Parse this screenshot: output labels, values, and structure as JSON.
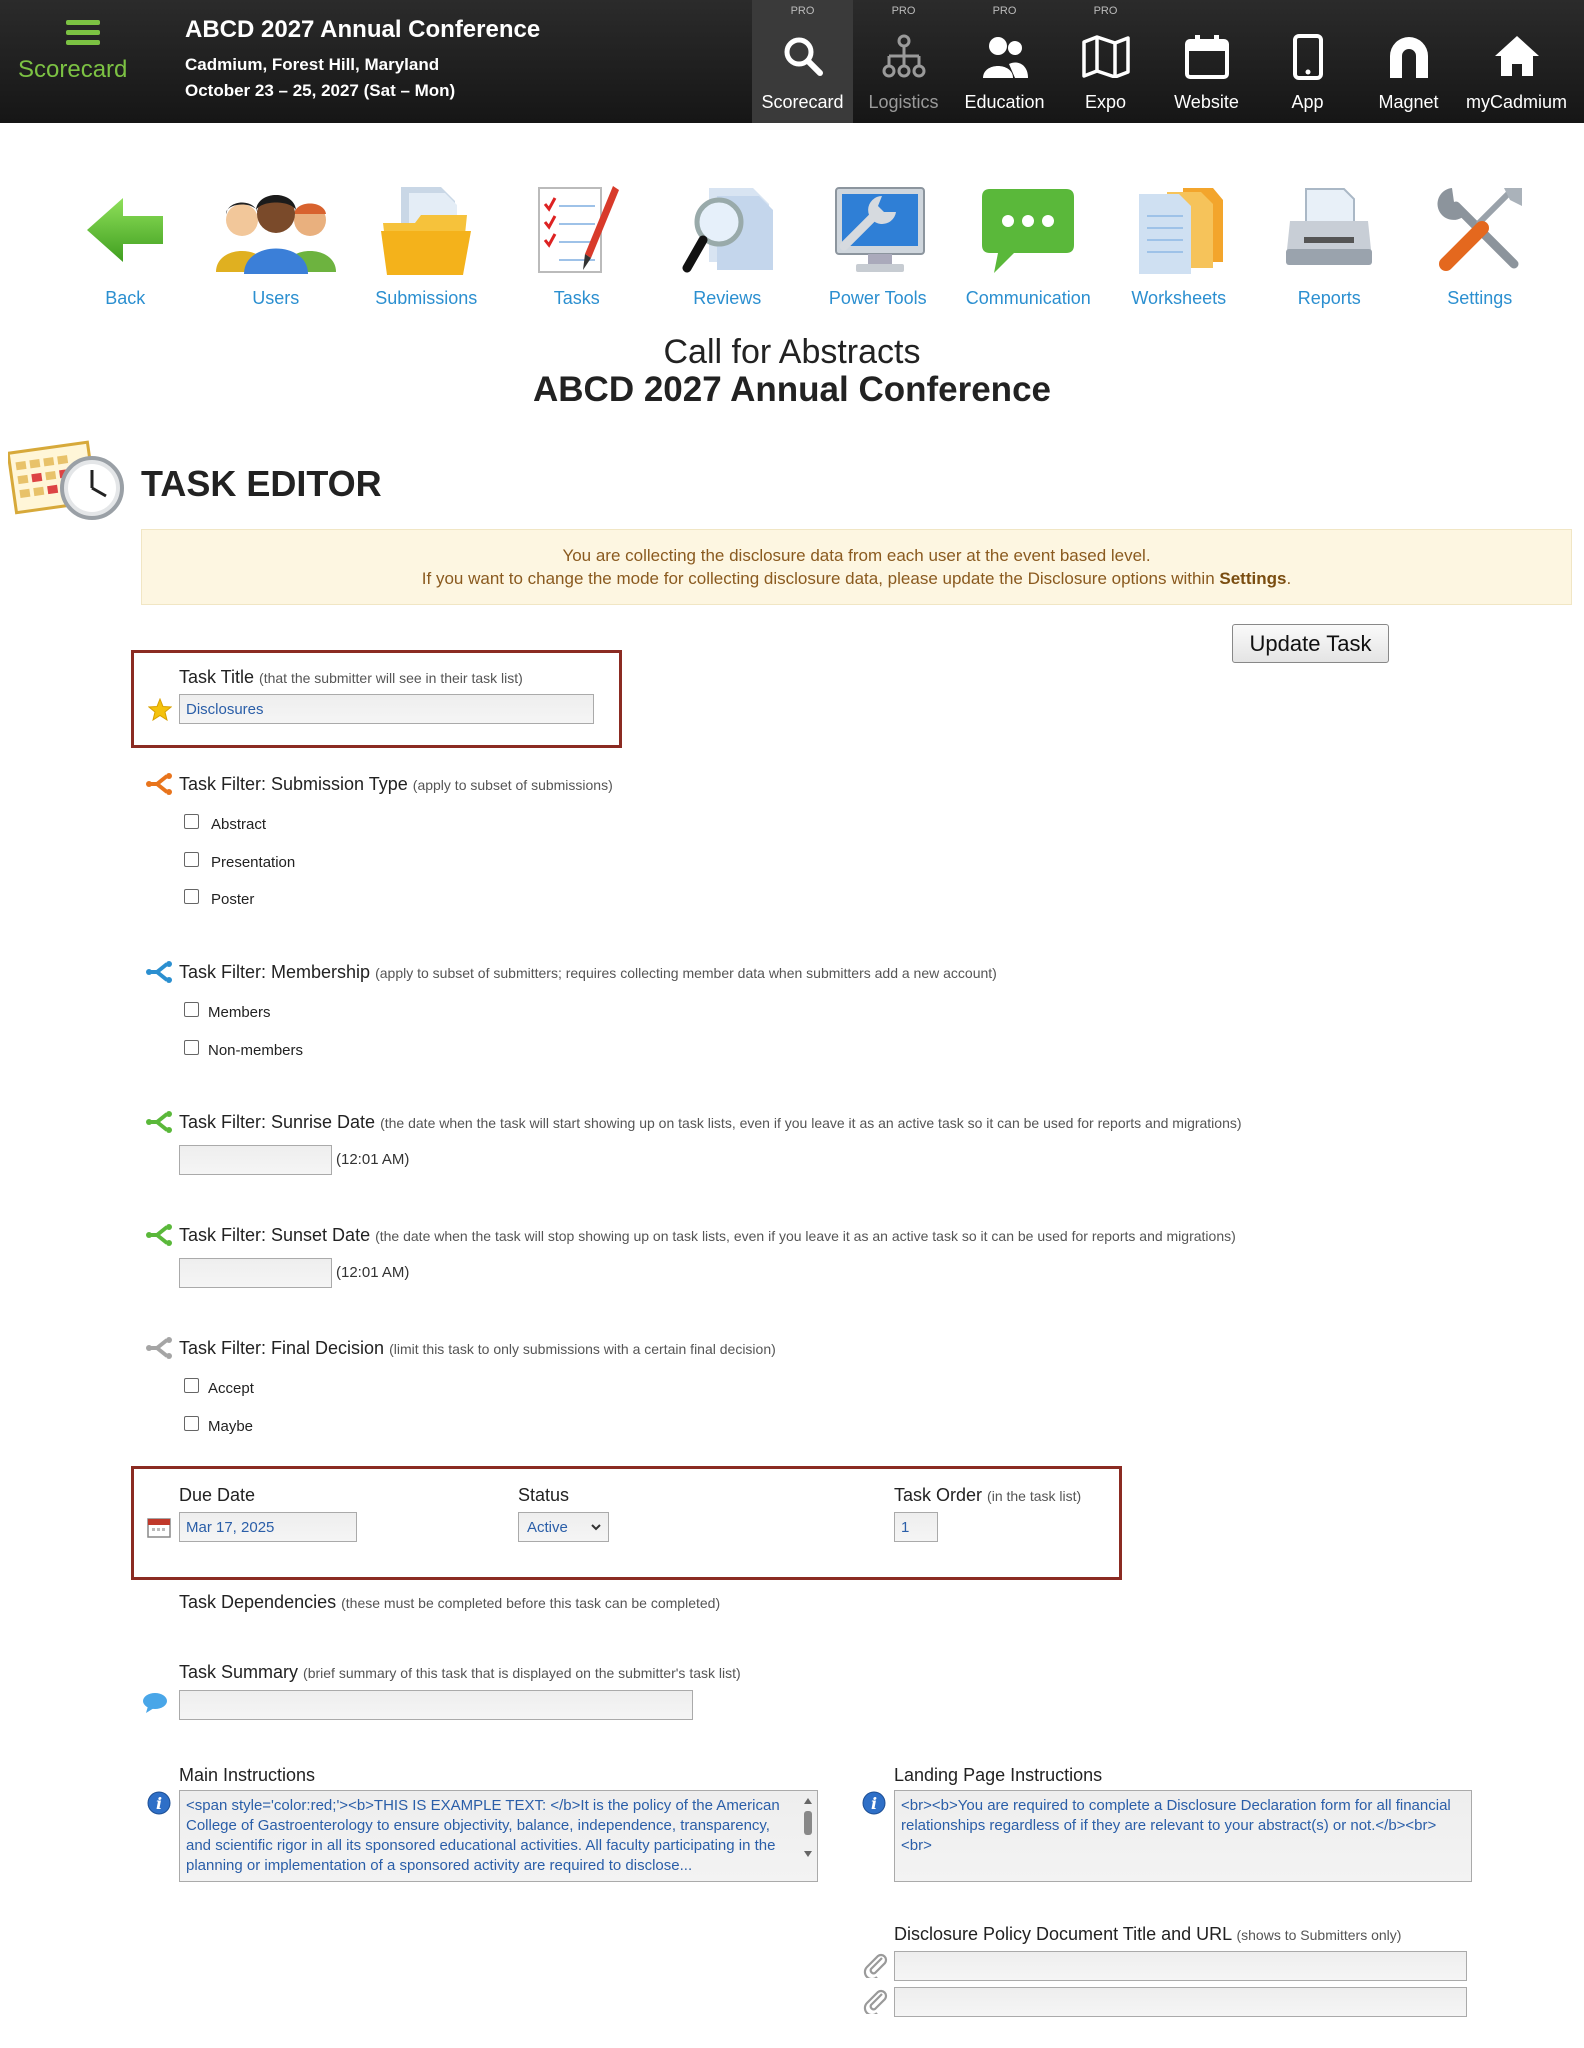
{
  "topbar": {
    "brand_label": "Scorecard",
    "conf_title": "ABCD 2027 Annual Conference",
    "conf_location": "Cadmium, Forest Hill, Maryland",
    "conf_dates": "October 23 – 25, 2027 (Sat – Mon)",
    "nav": [
      {
        "label": "Scorecard",
        "pro": "PRO",
        "icon": "search-icon"
      },
      {
        "label": "Logistics",
        "pro": "PRO",
        "icon": "org-chart-icon"
      },
      {
        "label": "Education",
        "pro": "PRO",
        "icon": "users-icon"
      },
      {
        "label": "Expo",
        "pro": "PRO",
        "icon": "map-icon"
      },
      {
        "label": "Website",
        "icon": "calendar-icon"
      },
      {
        "label": "App",
        "icon": "phone-icon"
      },
      {
        "label": "Magnet",
        "icon": "magnet-icon"
      },
      {
        "label": "myCadmium",
        "icon": "home-icon"
      }
    ]
  },
  "toolbar": [
    {
      "label": "Back",
      "icon": "back-arrow-icon"
    },
    {
      "label": "Users",
      "icon": "people-icon"
    },
    {
      "label": "Submissions",
      "icon": "folder-icon"
    },
    {
      "label": "Tasks",
      "icon": "checklist-icon"
    },
    {
      "label": "Reviews",
      "icon": "magnifier-icon"
    },
    {
      "label": "Power Tools",
      "icon": "monitor-wrench-icon"
    },
    {
      "label": "Communication",
      "icon": "chat-bubble-icon"
    },
    {
      "label": "Worksheets",
      "icon": "worksheets-icon"
    },
    {
      "label": "Reports",
      "icon": "printer-icon"
    },
    {
      "label": "Settings",
      "icon": "tools-icon"
    }
  ],
  "page": {
    "title_line1": "Call for Abstracts",
    "title_line2": "ABCD 2027 Annual Conference",
    "editor_title": "TASK EDITOR"
  },
  "notice": {
    "line1": "You are collecting the disclosure data from each user at the event based level.",
    "line2_pre": "If you want to change the mode for collecting disclosure data, please update the Disclosure options within ",
    "line2_bold": "Settings",
    "line2_post": "."
  },
  "update_button": "Update Task",
  "task_title": {
    "label": "Task Title",
    "hint": "(that the submitter will see in their task list)",
    "value": "Disclosures"
  },
  "filter_submission": {
    "label": "Task Filter: Submission Type",
    "hint": "(apply to subset of submissions)",
    "options": [
      "Abstract",
      "Presentation",
      "Poster"
    ]
  },
  "filter_membership": {
    "label": "Task Filter: Membership",
    "hint": "(apply to subset of submitters; requires collecting member data when submitters add a new account)",
    "options": [
      "Members",
      "Non-members"
    ]
  },
  "filter_sunrise": {
    "label": "Task Filter: Sunrise Date",
    "hint": "(the date when the task will start showing up on task lists, even if you leave it as an active task so it can be used for reports and migrations)",
    "time": "(12:01 AM)"
  },
  "filter_sunset": {
    "label": "Task Filter: Sunset Date",
    "hint": "(the date when the task will stop showing up on task lists, even if you leave it as an active task so it can be used for reports and migrations)",
    "time": "(12:01 AM)"
  },
  "filter_final": {
    "label": "Task Filter: Final Decision",
    "hint": "(limit this task to only submissions with a certain final decision)",
    "options": [
      "Accept",
      "Maybe"
    ]
  },
  "due_date": {
    "label": "Due Date",
    "value": "Mar 17, 2025"
  },
  "status": {
    "label": "Status",
    "value": "Active"
  },
  "task_order": {
    "label": "Task Order",
    "hint": "(in the task list)",
    "value": "1"
  },
  "dependencies": {
    "label": "Task Dependencies",
    "hint": "(these must be completed before this task can be completed)"
  },
  "summary": {
    "label": "Task Summary",
    "hint": "(brief summary of this task that is displayed on the submitter's task list)"
  },
  "main_instructions": {
    "label": "Main Instructions",
    "value": "<span style='color:red;'><b>THIS IS EXAMPLE TEXT: </b>It is the policy of the American College of Gastroenterology to ensure objectivity, balance, independence, transparency, and scientific rigor in all its sponsored educational activities. All faculty participating in the planning or implementation of a sponsored activity are required to disclose..."
  },
  "landing_instructions": {
    "label": "Landing Page Instructions",
    "value": "<br><b>You are required to complete a Disclosure Declaration form for all financial relationships regardless of if they are relevant to your abstract(s) or not.</b><br><br>"
  },
  "disclosure_policy": {
    "label": "Disclosure Policy Document Title and URL",
    "hint": "(shows to Submitters only)"
  },
  "colors": {
    "brand_green": "#7cc243",
    "link_blue": "#2b8fd0",
    "highlight_red": "#8b2b22",
    "notice_bg": "#fdf6e1"
  }
}
